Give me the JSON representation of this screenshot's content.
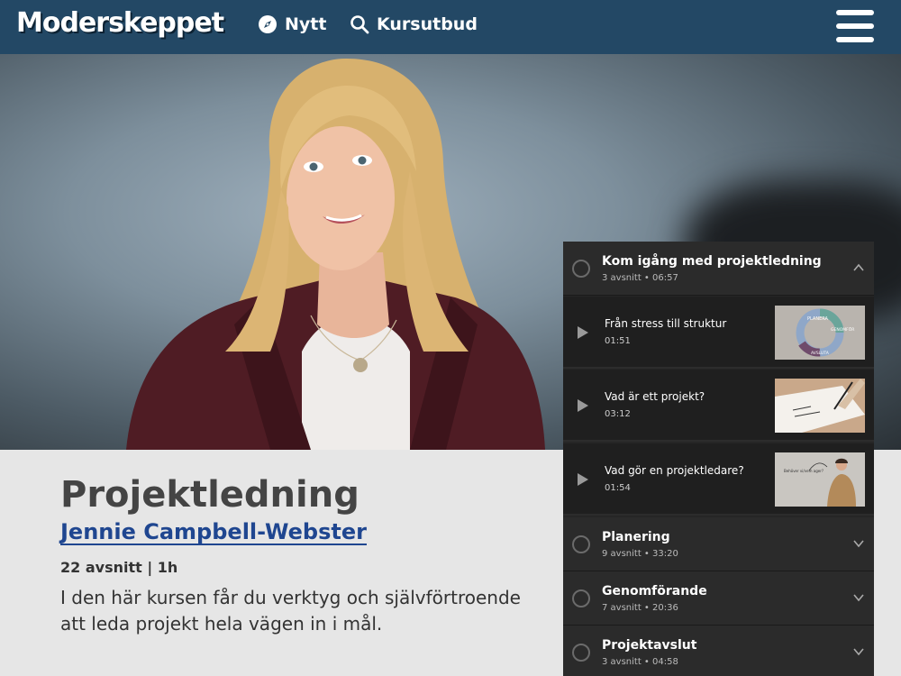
{
  "header": {
    "logo": "Moderskeppet",
    "nav": [
      {
        "label": "Nytt",
        "icon": "compass-icon"
      },
      {
        "label": "Kursutbud",
        "icon": "search-icon"
      }
    ],
    "menu_icon": "hamburger-menu-icon"
  },
  "course": {
    "title": "Projektledning",
    "author": "Jennie Campbell-Webster",
    "meta": "22 avsnitt | 1h",
    "description": "I den här kursen får du verktyg och självförtroende att leda projekt hela vägen in i mål."
  },
  "playlist": {
    "sections": [
      {
        "title": "Kom igång med projektledning",
        "subtitle": "3 avsnitt • 06:57",
        "expanded": true
      },
      {
        "title": "Planering",
        "subtitle": "9 avsnitt • 33:20",
        "expanded": false
      },
      {
        "title": "Genomförande",
        "subtitle": "7 avsnitt • 20:36",
        "expanded": false
      },
      {
        "title": "Projektavslut",
        "subtitle": "3 avsnitt • 04:58",
        "expanded": false
      }
    ],
    "episodes": [
      {
        "title": "Från stress till struktur",
        "duration": "01:51"
      },
      {
        "title": "Vad är ett projekt?",
        "duration": "03:12"
      },
      {
        "title": "Vad gör en projektledare?",
        "duration": "01:54"
      }
    ],
    "thumb_texts": {
      "cycle_top": "PLANERA",
      "cycle_right": "GENOMFÖR",
      "cycle_bottom": "AVSLUTA",
      "bubble": "Behöver vi/vem ager?"
    }
  },
  "colors": {
    "header_bg": "#234865",
    "author_link": "#1f4690",
    "page_bg": "#e6e6e6",
    "playlist_bg": "#262626"
  }
}
